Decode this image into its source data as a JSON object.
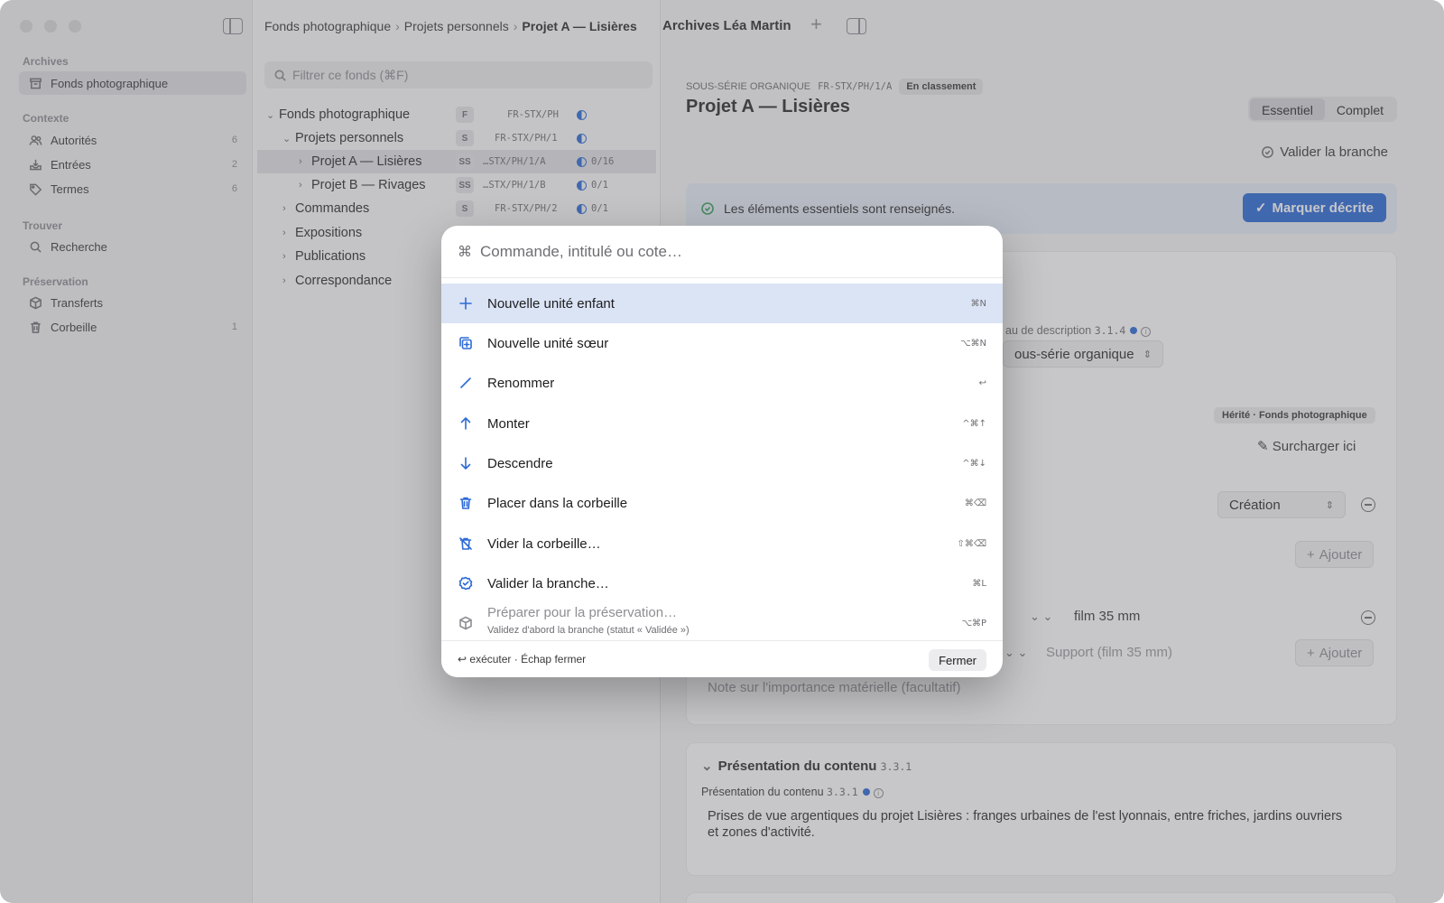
{
  "sidebar": {
    "sections": [
      {
        "title": "Archives"
      },
      {
        "title": "Contexte"
      },
      {
        "title": "Trouver"
      },
      {
        "title": "Préservation"
      }
    ],
    "items": {
      "fonds": {
        "label": "Fonds photographique"
      },
      "autorites": {
        "label": "Autorités",
        "count": "6"
      },
      "entrees": {
        "label": "Entrées",
        "count": "2"
      },
      "termes": {
        "label": "Termes",
        "count": "6"
      },
      "recherche": {
        "label": "Recherche"
      },
      "transferts": {
        "label": "Transferts"
      },
      "corbeille": {
        "label": "Corbeille",
        "count": "1"
      }
    }
  },
  "breadcrumb": [
    "Fonds photographique",
    "Projets personnels",
    "Projet A — Lisières"
  ],
  "filter": {
    "placeholder": "Filtrer ce fonds (⌘F)"
  },
  "tree": [
    {
      "label": "Fonds photographique",
      "level": "F",
      "ref": "FR-STX/PH",
      "progress": ""
    },
    {
      "label": "Projets personnels",
      "level": "S",
      "ref": "FR-STX/PH/1",
      "progress": ""
    },
    {
      "label": "Projet A — Lisières",
      "level": "SS",
      "ref": "…STX/PH/1/A",
      "progress": "0/16"
    },
    {
      "label": "Projet B — Rivages",
      "level": "SS",
      "ref": "…STX/PH/1/B",
      "progress": "0/1"
    },
    {
      "label": "Commandes",
      "level": "S",
      "ref": "FR-STX/PH/2",
      "progress": "0/1"
    },
    {
      "label": "Expositions"
    },
    {
      "label": "Publications"
    },
    {
      "label": "Correspondance"
    }
  ],
  "window_title": "Archives Léa Martin",
  "detail": {
    "kicker": "SOUS-SÉRIE ORGANIQUE",
    "code": "FR-STX/PH/1/A",
    "status": "En classement",
    "title": "Projet A — Lisières",
    "view_modes": [
      "Essentiel",
      "Complet"
    ],
    "validate_label": "Valider la branche",
    "banner_text": "Les éléments essentiels sont renseignés.",
    "mark_label": "Marquer décrite",
    "level_label": "au de description",
    "level_code": "3.1.4",
    "level_value": "ous-série organique",
    "inherited_chip": "Hérité · Fonds photographique",
    "override_label": "Surcharger ici",
    "creation_value": "Création",
    "add_label": "Ajouter",
    "film_value": "film 35 mm",
    "support_placeholder": "Support (film 35 mm)",
    "note_placeholder": "Note sur l'importance matérielle (facultatif)",
    "section_title": "Présentation du contenu",
    "section_code": "3.3.1",
    "field_label": "Présentation du contenu",
    "field_code": "3.3.1",
    "field_text_1": "Prises de vue argentiques du projet Lisières : franges urbaines de l'est lyonnais, entre friches, jardins ouvriers",
    "field_text_2": "et zones d'activité."
  },
  "palette": {
    "placeholder": "Commande, intitulé ou cote…",
    "commands": [
      {
        "label": "Nouvelle unité enfant",
        "shortcut": "⌘N",
        "icon": "plus-icon"
      },
      {
        "label": "Nouvelle unité sœur",
        "shortcut": "⌥⌘N",
        "icon": "duplicate-plus-icon"
      },
      {
        "label": "Renommer",
        "shortcut": "↩",
        "icon": "pencil-icon"
      },
      {
        "label": "Monter",
        "shortcut": "^⌘↑",
        "icon": "arrow-up-icon"
      },
      {
        "label": "Descendre",
        "shortcut": "^⌘↓",
        "icon": "arrow-down-icon"
      },
      {
        "label": "Placer dans la corbeille",
        "shortcut": "⌘⌫",
        "icon": "trash-icon"
      },
      {
        "label": "Vider la corbeille…",
        "shortcut": "⇧⌘⌫",
        "icon": "trash-slash-icon"
      },
      {
        "label": "Valider la branche…",
        "shortcut": "⌘L",
        "icon": "checkmark-seal-icon"
      },
      {
        "label": "Préparer pour la préservation…",
        "sublabel": "Validez d'abord la branche (statut « Validée »)",
        "shortcut": "⌥⌘P",
        "icon": "package-icon"
      }
    ],
    "footer_hint": "↩ exécuter · Échap fermer",
    "close_label": "Fermer"
  },
  "colors": {
    "accent": "#2d6bd6",
    "highlight": "#dbe4f5",
    "success": "#3aa05a"
  }
}
